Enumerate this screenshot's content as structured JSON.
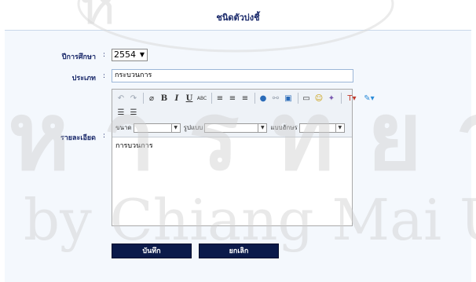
{
  "page": {
    "title": "ชนิดตัวบ่งชี้"
  },
  "form": {
    "year": {
      "label": "ปีการศึกษา",
      "colon": ":",
      "value": "2554"
    },
    "type": {
      "label": "ประเภท",
      "colon": ":",
      "value": "กระบวนการ"
    },
    "detail": {
      "label": "รายละเอียด",
      "colon": ":",
      "value": "การบวนการ"
    }
  },
  "editor": {
    "toolbar": {
      "text_color_glyph": "T",
      "size_label": "ขนาด",
      "format_label": "รูปแบบ",
      "font_label": "แบบอักษร",
      "icons": [
        "undo-icon",
        "redo-icon",
        "eraser-icon",
        "bold-icon",
        "italic-icon",
        "underline-icon",
        "spellcheck-icon",
        "align-left-icon",
        "align-center-icon",
        "align-right-icon",
        "link-icon",
        "unlink-icon",
        "image-icon",
        "table-icon",
        "smiley-icon",
        "special-char-icon",
        "text-color-icon",
        "highlight-icon",
        "numbered-list-icon",
        "bullet-list-icon"
      ]
    }
  },
  "buttons": {
    "save": "บันทึก",
    "cancel": "ยกเลิก"
  },
  "colors": {
    "button_bg": "#0b1a4a",
    "label_text": "#1b2a6b",
    "panel_bg": "#f4f8fd"
  }
}
